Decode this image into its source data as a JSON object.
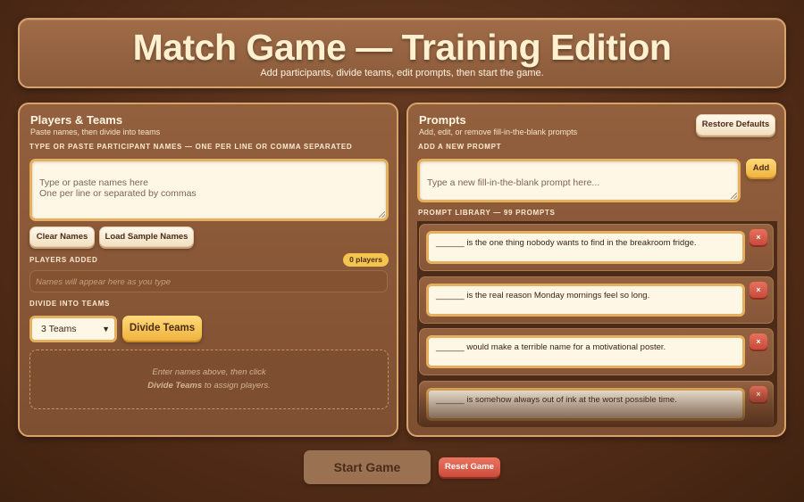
{
  "header": {
    "title": "Match Game — Training Edition",
    "subtitle": "Add participants, divide teams, edit prompts, then start the game."
  },
  "players": {
    "title": "Players & Teams",
    "subtitle": "Paste names, then divide into teams",
    "input_label": "Type or paste participant names — one per line or comma separated",
    "input_placeholder": "Type or paste names here\nOne per line or separated by commas",
    "clear_label": "Clear Names",
    "load_sample_label": "Load Sample Names",
    "added_label": "Players added",
    "count_badge": "0 players",
    "names_placeholder": "Names will appear here as you type",
    "divide_label": "Divide into teams",
    "team_select": "3 Teams",
    "divide_button": "Divide Teams",
    "hint_line1": "Enter names above, then click",
    "hint_strong": "Divide Teams",
    "hint_rest": " to assign players."
  },
  "prompts": {
    "title": "Prompts",
    "subtitle": "Add, edit, or remove fill-in-the-blank prompts",
    "restore_label": "Restore Defaults",
    "add_label": "Add a new prompt",
    "add_placeholder": "Type a new fill-in-the-blank prompt here...",
    "add_button": "Add",
    "library_label": "Prompt library — 99 prompts",
    "remove_symbol": "×",
    "items": [
      "______ is the one thing nobody wants to find in the breakroom fridge.",
      "______ is the real reason Monday mornings feel so long.",
      "______ would make a terrible name for a motivational poster.",
      "______ is somehow always out of ink at the worst possible time."
    ]
  },
  "footer": {
    "start_label": "Start Game",
    "reset_label": "Reset Game"
  },
  "colors": {
    "background": "#5a321c",
    "panel": "#8a5a3a",
    "border": "#d8a36a",
    "accent_gold": "#f4c54e",
    "danger": "#d85a46"
  }
}
